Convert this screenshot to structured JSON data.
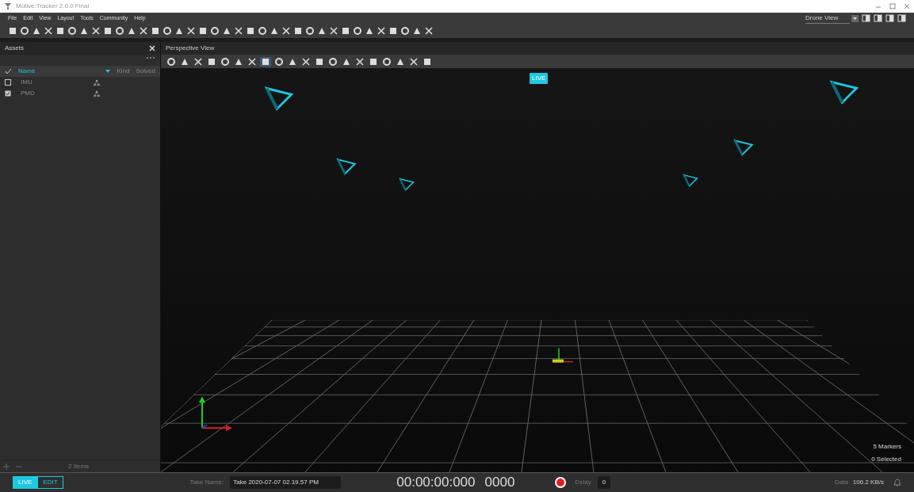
{
  "window": {
    "title": "Motive:Tracker 2.0.0 Final"
  },
  "menu": [
    "File",
    "Edit",
    "View",
    "Layout",
    "Tools",
    "Community",
    "Help"
  ],
  "layout_select": {
    "value": "Drone View"
  },
  "assets_panel": {
    "title": "Assets",
    "columns": [
      "Name",
      "Kind",
      "Solved"
    ],
    "rows": [
      {
        "name": "IMU",
        "checked": false
      },
      {
        "name": "PMD",
        "checked": true
      }
    ],
    "footer": "2 Items"
  },
  "viewport": {
    "title": "Perspective View",
    "tools": [
      {
        "selected": false
      },
      {
        "selected": false
      },
      {
        "selected": false
      },
      {
        "selected": false
      },
      {
        "selected": false
      },
      {
        "selected": false
      },
      {
        "selected": false
      },
      {
        "selected": true
      },
      {
        "selected": false
      },
      {
        "selected": false
      },
      {
        "selected": false
      },
      {
        "selected": false
      },
      {
        "selected": false
      },
      {
        "selected": false
      },
      {
        "selected": false
      },
      {
        "selected": false
      },
      {
        "selected": false
      },
      {
        "selected": false
      },
      {
        "selected": false
      },
      {
        "selected": false
      }
    ],
    "badge": "LIVE",
    "markers": "5 Markers",
    "selected_count": "0 Selected"
  },
  "status_bar": {
    "modes": [
      {
        "label": "LIVE",
        "selected": true
      },
      {
        "label": "EDIT",
        "selected": false
      }
    ],
    "take_label": "Take Name:",
    "take_value": "Take 2020-07-07 02.19.57 PM",
    "timecode": "00:00:00:000",
    "frame": "0000",
    "delay_label": "Delay",
    "delay_value": "0",
    "data_label": "Data",
    "data_value": "106.2 KB/s"
  }
}
